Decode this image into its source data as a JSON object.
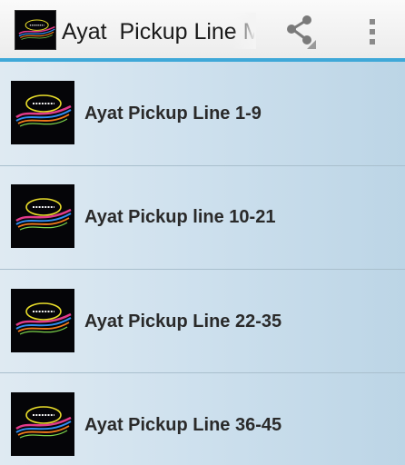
{
  "action_bar": {
    "title": "Ayat  Pickup Line M",
    "logo_icon": "app-logo-icon",
    "share_icon": "share-icon",
    "overflow_icon": "overflow-menu-icon"
  },
  "list": {
    "items": [
      {
        "label": "Ayat Pickup Line 1-9",
        "icon": "app-logo-icon"
      },
      {
        "label": "Ayat Pickup line 10-21",
        "icon": "app-logo-icon"
      },
      {
        "label": "Ayat Pickup Line 22-35",
        "icon": "app-logo-icon"
      },
      {
        "label": "Ayat Pickup Line 36-45",
        "icon": "app-logo-icon"
      }
    ]
  },
  "colors": {
    "accent_rule": "#3fa8d8",
    "list_background": "#c4dbe9",
    "text": "#2a2a2a"
  }
}
